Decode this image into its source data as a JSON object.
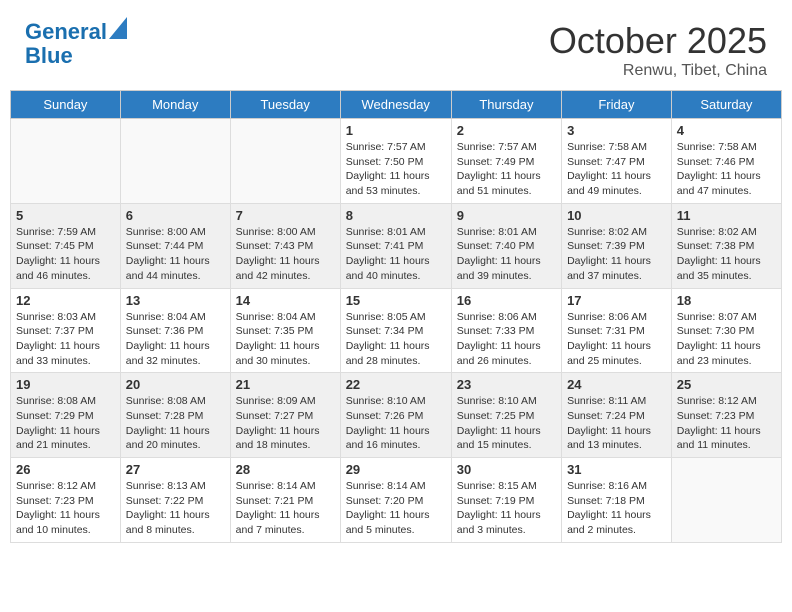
{
  "header": {
    "logo_line1": "General",
    "logo_line2": "Blue",
    "month": "October 2025",
    "location": "Renwu, Tibet, China"
  },
  "days_of_week": [
    "Sunday",
    "Monday",
    "Tuesday",
    "Wednesday",
    "Thursday",
    "Friday",
    "Saturday"
  ],
  "weeks": [
    [
      {
        "day": "",
        "info": ""
      },
      {
        "day": "",
        "info": ""
      },
      {
        "day": "",
        "info": ""
      },
      {
        "day": "1",
        "info": "Sunrise: 7:57 AM\nSunset: 7:50 PM\nDaylight: 11 hours and 53 minutes."
      },
      {
        "day": "2",
        "info": "Sunrise: 7:57 AM\nSunset: 7:49 PM\nDaylight: 11 hours and 51 minutes."
      },
      {
        "day": "3",
        "info": "Sunrise: 7:58 AM\nSunset: 7:47 PM\nDaylight: 11 hours and 49 minutes."
      },
      {
        "day": "4",
        "info": "Sunrise: 7:58 AM\nSunset: 7:46 PM\nDaylight: 11 hours and 47 minutes."
      }
    ],
    [
      {
        "day": "5",
        "info": "Sunrise: 7:59 AM\nSunset: 7:45 PM\nDaylight: 11 hours and 46 minutes."
      },
      {
        "day": "6",
        "info": "Sunrise: 8:00 AM\nSunset: 7:44 PM\nDaylight: 11 hours and 44 minutes."
      },
      {
        "day": "7",
        "info": "Sunrise: 8:00 AM\nSunset: 7:43 PM\nDaylight: 11 hours and 42 minutes."
      },
      {
        "day": "8",
        "info": "Sunrise: 8:01 AM\nSunset: 7:41 PM\nDaylight: 11 hours and 40 minutes."
      },
      {
        "day": "9",
        "info": "Sunrise: 8:01 AM\nSunset: 7:40 PM\nDaylight: 11 hours and 39 minutes."
      },
      {
        "day": "10",
        "info": "Sunrise: 8:02 AM\nSunset: 7:39 PM\nDaylight: 11 hours and 37 minutes."
      },
      {
        "day": "11",
        "info": "Sunrise: 8:02 AM\nSunset: 7:38 PM\nDaylight: 11 hours and 35 minutes."
      }
    ],
    [
      {
        "day": "12",
        "info": "Sunrise: 8:03 AM\nSunset: 7:37 PM\nDaylight: 11 hours and 33 minutes."
      },
      {
        "day": "13",
        "info": "Sunrise: 8:04 AM\nSunset: 7:36 PM\nDaylight: 11 hours and 32 minutes."
      },
      {
        "day": "14",
        "info": "Sunrise: 8:04 AM\nSunset: 7:35 PM\nDaylight: 11 hours and 30 minutes."
      },
      {
        "day": "15",
        "info": "Sunrise: 8:05 AM\nSunset: 7:34 PM\nDaylight: 11 hours and 28 minutes."
      },
      {
        "day": "16",
        "info": "Sunrise: 8:06 AM\nSunset: 7:33 PM\nDaylight: 11 hours and 26 minutes."
      },
      {
        "day": "17",
        "info": "Sunrise: 8:06 AM\nSunset: 7:31 PM\nDaylight: 11 hours and 25 minutes."
      },
      {
        "day": "18",
        "info": "Sunrise: 8:07 AM\nSunset: 7:30 PM\nDaylight: 11 hours and 23 minutes."
      }
    ],
    [
      {
        "day": "19",
        "info": "Sunrise: 8:08 AM\nSunset: 7:29 PM\nDaylight: 11 hours and 21 minutes."
      },
      {
        "day": "20",
        "info": "Sunrise: 8:08 AM\nSunset: 7:28 PM\nDaylight: 11 hours and 20 minutes."
      },
      {
        "day": "21",
        "info": "Sunrise: 8:09 AM\nSunset: 7:27 PM\nDaylight: 11 hours and 18 minutes."
      },
      {
        "day": "22",
        "info": "Sunrise: 8:10 AM\nSunset: 7:26 PM\nDaylight: 11 hours and 16 minutes."
      },
      {
        "day": "23",
        "info": "Sunrise: 8:10 AM\nSunset: 7:25 PM\nDaylight: 11 hours and 15 minutes."
      },
      {
        "day": "24",
        "info": "Sunrise: 8:11 AM\nSunset: 7:24 PM\nDaylight: 11 hours and 13 minutes."
      },
      {
        "day": "25",
        "info": "Sunrise: 8:12 AM\nSunset: 7:23 PM\nDaylight: 11 hours and 11 minutes."
      }
    ],
    [
      {
        "day": "26",
        "info": "Sunrise: 8:12 AM\nSunset: 7:23 PM\nDaylight: 11 hours and 10 minutes."
      },
      {
        "day": "27",
        "info": "Sunrise: 8:13 AM\nSunset: 7:22 PM\nDaylight: 11 hours and 8 minutes."
      },
      {
        "day": "28",
        "info": "Sunrise: 8:14 AM\nSunset: 7:21 PM\nDaylight: 11 hours and 7 minutes."
      },
      {
        "day": "29",
        "info": "Sunrise: 8:14 AM\nSunset: 7:20 PM\nDaylight: 11 hours and 5 minutes."
      },
      {
        "day": "30",
        "info": "Sunrise: 8:15 AM\nSunset: 7:19 PM\nDaylight: 11 hours and 3 minutes."
      },
      {
        "day": "31",
        "info": "Sunrise: 8:16 AM\nSunset: 7:18 PM\nDaylight: 11 hours and 2 minutes."
      },
      {
        "day": "",
        "info": ""
      }
    ]
  ]
}
